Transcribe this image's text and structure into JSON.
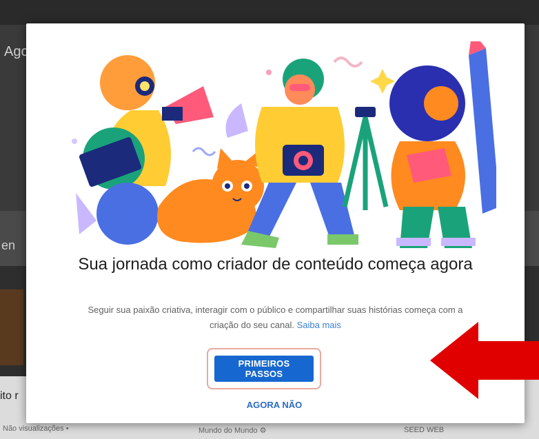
{
  "background": {
    "top_left_text": "Ago",
    "side_text": "en",
    "lower_left_text": "ito r",
    "bottom_left_text": "Não visualizações •",
    "bottom_mid_text": "Mundo do Mundo ⚙",
    "bottom_right_text": "SEED WEB"
  },
  "modal": {
    "title": "Sua jornada como criador de conteúdo começa agora",
    "description": "Seguir sua paixão criativa, interagir com o público e compartilhar suas histórias começa com a criação do seu canal.",
    "learn_more_link": "Saiba mais",
    "primary_button": "PRIMEIROS PASSOS",
    "secondary_button": "AGORA NÃO"
  },
  "colors": {
    "primary": "#1667cf",
    "link": "#3a7fd5",
    "annotation_arrow": "#e00000",
    "highlight_outline": "#e9a8a0"
  },
  "icons": {
    "illustration": "creators-illustration",
    "annotation": "red-arrow-icon"
  }
}
